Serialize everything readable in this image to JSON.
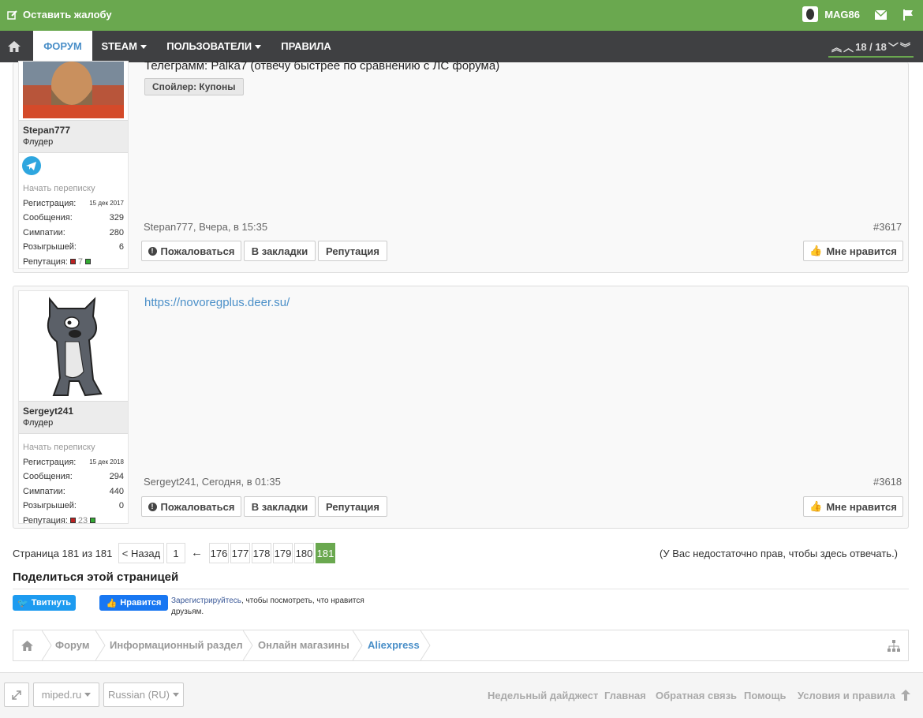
{
  "topbar": {
    "complain": "Оставить жалобу",
    "username": "MAG86"
  },
  "nav": {
    "forum": "ФОРУМ",
    "steam": "STEAM",
    "users": "ПОЛЬЗОВАТЕЛИ",
    "rules": "ПРАВИЛА",
    "page_counter": "18 / 18"
  },
  "post1": {
    "text": "Телеграмм: Palka7 (отвечу быстрее по сравнению с ЛС форума)",
    "spoiler": "Спойлер: Купоны",
    "username": "Stepan777",
    "rank": "Флудер",
    "start_conversation": "Начать переписку",
    "reg_label": "Регистрация:",
    "reg_value": "15 дек 2017",
    "msgs_label": "Сообщения:",
    "msgs_value": "329",
    "likes_label": "Симпатии:",
    "likes_value": "280",
    "giveaways_label": "Розыгрышей:",
    "giveaways_value": "6",
    "rep_label": "Репутация:",
    "rep_value": "7",
    "meta": "Stepan777, Вчера, в 15:35",
    "number": "#3617"
  },
  "post2": {
    "link": "https://novoregplus.deer.su/",
    "username": "Sergeyt241",
    "rank": "Флудер",
    "start_conversation": "Начать переписку",
    "reg_label": "Регистрация:",
    "reg_value": "15 дек 2018",
    "msgs_label": "Сообщения:",
    "msgs_value": "294",
    "likes_label": "Симпатии:",
    "likes_value": "440",
    "giveaways_label": "Розыгрышей:",
    "giveaways_value": "0",
    "rep_label": "Репутация:",
    "rep_value": "23",
    "meta": "Sergeyt241, Сегодня, в 01:35",
    "number": "#3618"
  },
  "actions": {
    "report": "Пожаловаться",
    "bookmark": "В закладки",
    "reputation": "Репутация",
    "like": "Мне нравится"
  },
  "pagination": {
    "info": "Страница 181 из 181",
    "back": "< Назад",
    "p1": "1",
    "arrow": "←",
    "p176": "176",
    "p177": "177",
    "p178": "178",
    "p179": "179",
    "p180": "180",
    "p181": "181",
    "no_rights": "(У Вас недостаточно прав, чтобы здесь отвечать.)"
  },
  "share": {
    "title": "Поделиться этой страницей",
    "tweet": "Твитнуть",
    "fb_like": "Нравится",
    "register_link": "Зарегистрируйтесь",
    "register_text": ", чтобы посмотреть, что нравится",
    "register_text2": "друзьям."
  },
  "breadcrumbs": {
    "forum": "Форум",
    "info": "Информационный раздел",
    "shops": "Онлайн магазины",
    "current": "Aliexpress"
  },
  "footer": {
    "site": "miped.ru",
    "lang": "Russian (RU)",
    "digest": "Недельный дайджест",
    "home": "Главная",
    "feedback": "Обратная связь",
    "help": "Помощь",
    "terms": "Условия и правила"
  },
  "colors": {
    "accent": "#6aa84f",
    "nav": "#3f4042",
    "link": "#4a8fc8"
  }
}
